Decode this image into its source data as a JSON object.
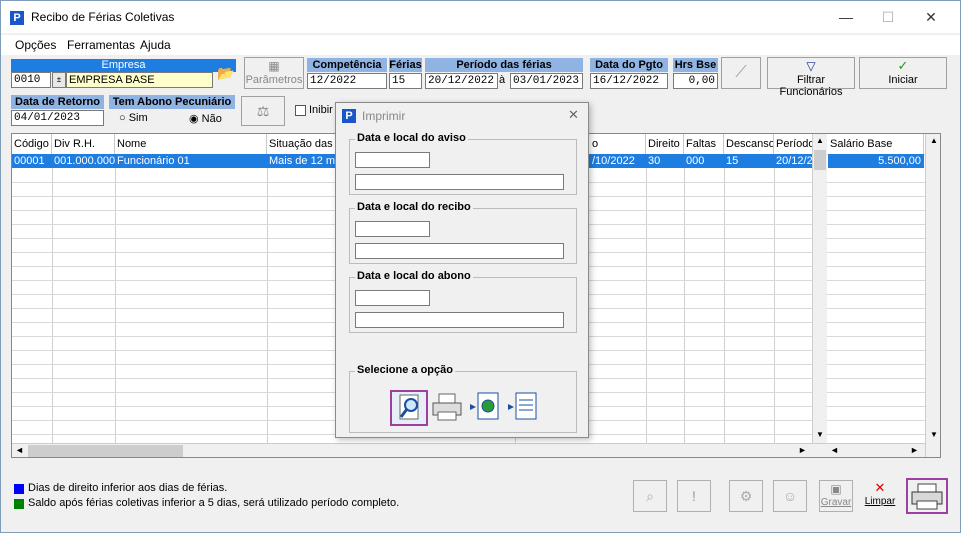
{
  "window": {
    "title": "Recibo de Férias Coletivas",
    "minimize": "—",
    "maximize": "☐",
    "close": "✕"
  },
  "menu": [
    "Opções",
    "Ferramentas",
    "Ajuda"
  ],
  "empresa": {
    "label": "Empresa",
    "code": "0010",
    "name": "EMPRESA BASE"
  },
  "parametros_label": "Parâmetros",
  "competencia": {
    "label": "Competência",
    "value": "12/2022"
  },
  "ferias": {
    "label": "Férias",
    "value": "15"
  },
  "periodo": {
    "label": "Período das férias",
    "start": "20/12/2022",
    "sep": "à",
    "end": "03/01/2023"
  },
  "data_pgto": {
    "label": "Data do Pgto",
    "value": "16/12/2022"
  },
  "hrs_base": {
    "label": "Hrs Bse",
    "value": "0,00"
  },
  "filtrar_label": "Filtrar Funcionários",
  "iniciar_label": "Iniciar",
  "data_retorno": {
    "label": "Data de Retorno",
    "value": "04/01/2023"
  },
  "abono": {
    "label": "Tem Abono Pecuniário",
    "sim": "Sim",
    "nao": "Não"
  },
  "inibir_label": "Inibir",
  "table": {
    "headers": [
      "Código",
      "Div R.H.",
      "Nome",
      "Situação das Fé",
      "o",
      "Direito",
      "Faltas",
      "Descanso",
      "Período",
      "Salário Base"
    ],
    "row": [
      "00001",
      "001.000.000",
      "Funcionário 01",
      "Mais de 12 mes",
      "/10/2022",
      "30",
      "000",
      "15",
      "20/12/2",
      "5.500,00"
    ]
  },
  "dialog": {
    "title": "Imprimir",
    "close": "✕",
    "aviso": "Data e local do aviso",
    "recibo": "Data e local do recibo",
    "abono": "Data e local do abono",
    "opcao": "Selecione a opção"
  },
  "legend": {
    "blue_text": "Dias de direito inferior aos dias de férias.",
    "green_text": "Saldo após férias coletivas inferior a 5 dias, será utilizado período completo.",
    "blue_color": "#0000ff",
    "green_color": "#008000"
  },
  "bottom": {
    "gravar": "Gravar",
    "limpar": "Limpar"
  },
  "colors": {
    "accent": "#1e7de0",
    "header_blue": "#8fb4e3",
    "highlight": "#9b3fa0"
  }
}
